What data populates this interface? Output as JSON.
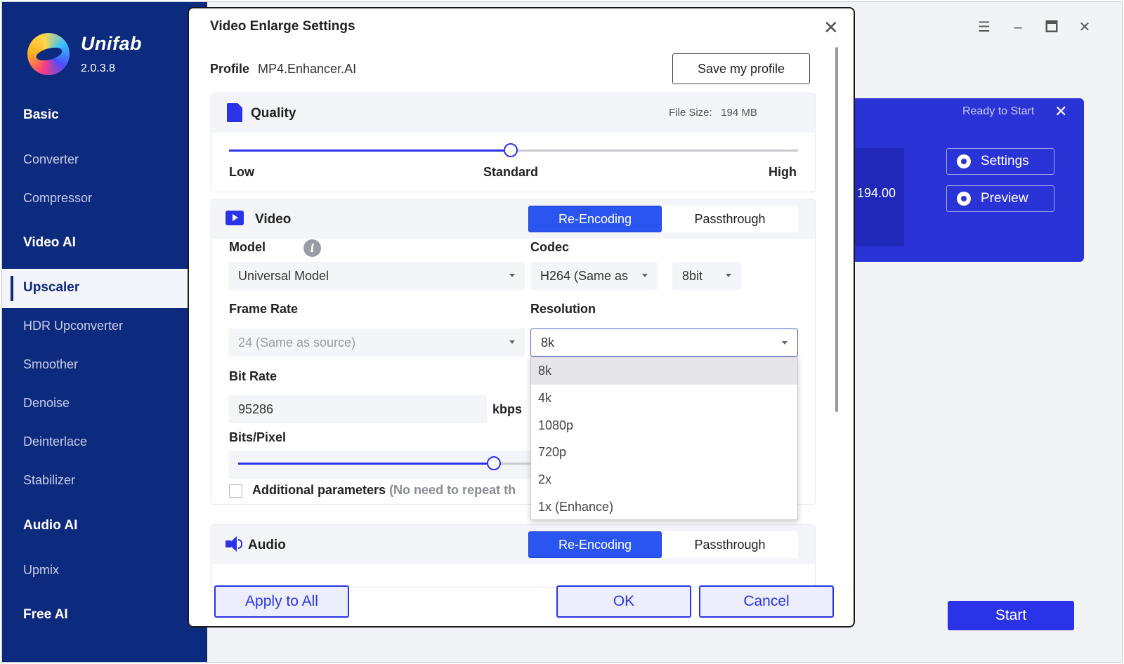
{
  "app": {
    "brand": "Unifab",
    "version": "2.0.3.8"
  },
  "sidebar": {
    "sections": [
      {
        "label": "Basic"
      },
      {
        "label": "Video AI"
      },
      {
        "label": "Audio AI"
      },
      {
        "label": "Free AI"
      }
    ],
    "items": [
      {
        "label": "Converter"
      },
      {
        "label": "Compressor"
      },
      {
        "label": "Upscaler",
        "active": true
      },
      {
        "label": "HDR Upconverter"
      },
      {
        "label": "Smoother"
      },
      {
        "label": "Denoise"
      },
      {
        "label": "Deinterlace"
      },
      {
        "label": "Stabilizer"
      },
      {
        "label": "Upmix"
      }
    ]
  },
  "window_controls": {
    "menu_icon": "hamburger-icon",
    "minimize_icon": "minimize-icon",
    "maximize_icon": "maximize-icon",
    "close_icon": "close-icon"
  },
  "task": {
    "status": "Ready to Start",
    "size": "194.00",
    "settings_label": "Settings",
    "preview_label": "Preview"
  },
  "start_label": "Start",
  "dialog": {
    "title": "Video Enlarge Settings",
    "profile_label": "Profile",
    "profile_value": "MP4.Enhancer.AI",
    "save_profile_label": "Save my profile",
    "quality": {
      "title": "Quality",
      "file_size_label": "File Size:",
      "file_size_value": "194 MB",
      "low_label": "Low",
      "standard_label": "Standard",
      "high_label": "High",
      "level": 0.5
    },
    "video": {
      "title": "Video",
      "re_encoding_label": "Re-Encoding",
      "passthrough_label": "Passthrough",
      "model_label": "Model",
      "model_value": "Universal Model",
      "codec_label": "Codec",
      "codec_value": "H264 (Same as",
      "bitdepth_value": "8bit",
      "frame_rate_label": "Frame Rate",
      "frame_rate_value": "24 (Same as source)",
      "resolution_label": "Resolution",
      "resolution_value": "8k",
      "resolution_options": [
        "8k",
        "4k",
        "1080p",
        "720p",
        "2x",
        "1x (Enhance)"
      ],
      "bit_rate_label": "Bit Rate",
      "bit_rate_value": "95286",
      "bit_rate_unit": "kbps",
      "bits_pixel_label": "Bits/Pixel",
      "additional_params_label": "Additional parameters",
      "additional_params_hint": "(No need to repeat th"
    },
    "audio": {
      "title": "Audio",
      "re_encoding_label": "Re-Encoding",
      "passthrough_label": "Passthrough"
    },
    "apply_all_label": "Apply to All",
    "ok_label": "OK",
    "cancel_label": "Cancel"
  },
  "colors": {
    "sidebar": "#0d2b7e",
    "accent": "#2a33e8",
    "task_card": "#2a33d6"
  }
}
